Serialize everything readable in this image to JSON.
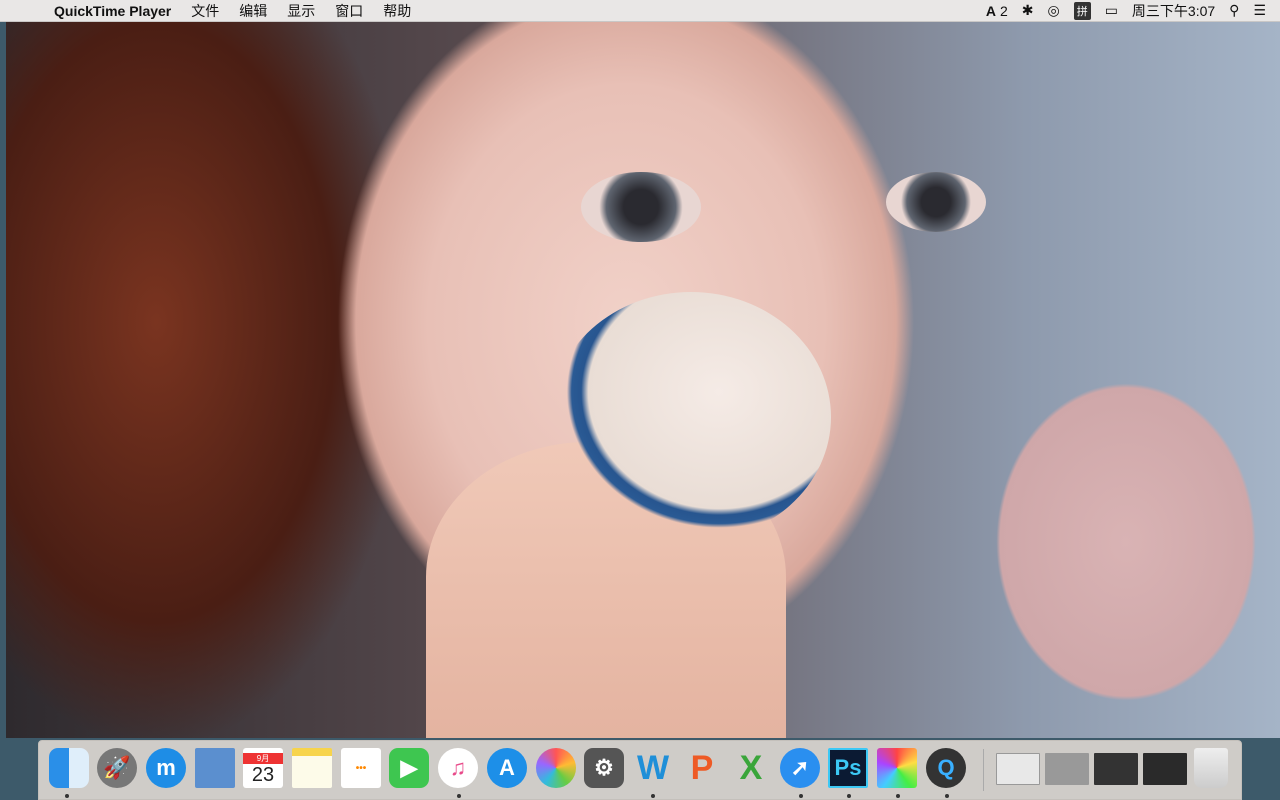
{
  "menubar": {
    "app_name": "QuickTime Player",
    "menus": [
      "文件",
      "编辑",
      "显示",
      "窗口",
      "帮助"
    ],
    "status": {
      "adobe_count": "2",
      "input_method": "拼",
      "clock": "周三下午3:07"
    }
  },
  "dock": {
    "apps": [
      {
        "name": "Finder",
        "icon": "finder-icon",
        "running": true
      },
      {
        "name": "Launchpad",
        "icon": "rocket-icon",
        "running": false
      },
      {
        "name": "Maxthon",
        "icon": "maxthon-icon",
        "running": false
      },
      {
        "name": "Mail",
        "icon": "mail-stamp-icon",
        "running": false
      },
      {
        "name": "Calendar",
        "icon": "calendar-icon",
        "running": false,
        "month": "9月",
        "day": "23"
      },
      {
        "name": "Notes",
        "icon": "notes-icon",
        "running": false
      },
      {
        "name": "Reminders",
        "icon": "reminders-icon",
        "running": false
      },
      {
        "name": "FaceTime",
        "icon": "facetime-icon",
        "running": false
      },
      {
        "name": "iTunes",
        "icon": "music-note-icon",
        "running": true
      },
      {
        "name": "App Store",
        "icon": "app-store-icon",
        "running": false
      },
      {
        "name": "Photos",
        "icon": "photos-icon",
        "running": false
      },
      {
        "name": "System Preferences",
        "icon": "gear-icon",
        "running": false
      },
      {
        "name": "Word",
        "icon": "word-icon",
        "label": "W",
        "running": true
      },
      {
        "name": "PowerPoint",
        "icon": "powerpoint-icon",
        "label": "P",
        "running": false
      },
      {
        "name": "Excel",
        "icon": "excel-icon",
        "label": "X",
        "running": false
      },
      {
        "name": "Safari",
        "icon": "compass-icon",
        "running": true
      },
      {
        "name": "Photoshop",
        "icon": "photoshop-icon",
        "label": "Ps",
        "running": true
      },
      {
        "name": "Final Cut Pro",
        "icon": "clapper-icon",
        "running": true
      },
      {
        "name": "QuickTime Player",
        "icon": "quicktime-icon",
        "label": "Q",
        "running": true
      }
    ],
    "minimized": [
      "word-window",
      "safari-window",
      "photoshop-window",
      "finalcut-window"
    ],
    "trash": "trash-icon"
  },
  "colors": {
    "menubar": "#e9e7e6",
    "dock": "#d7d3ce"
  }
}
